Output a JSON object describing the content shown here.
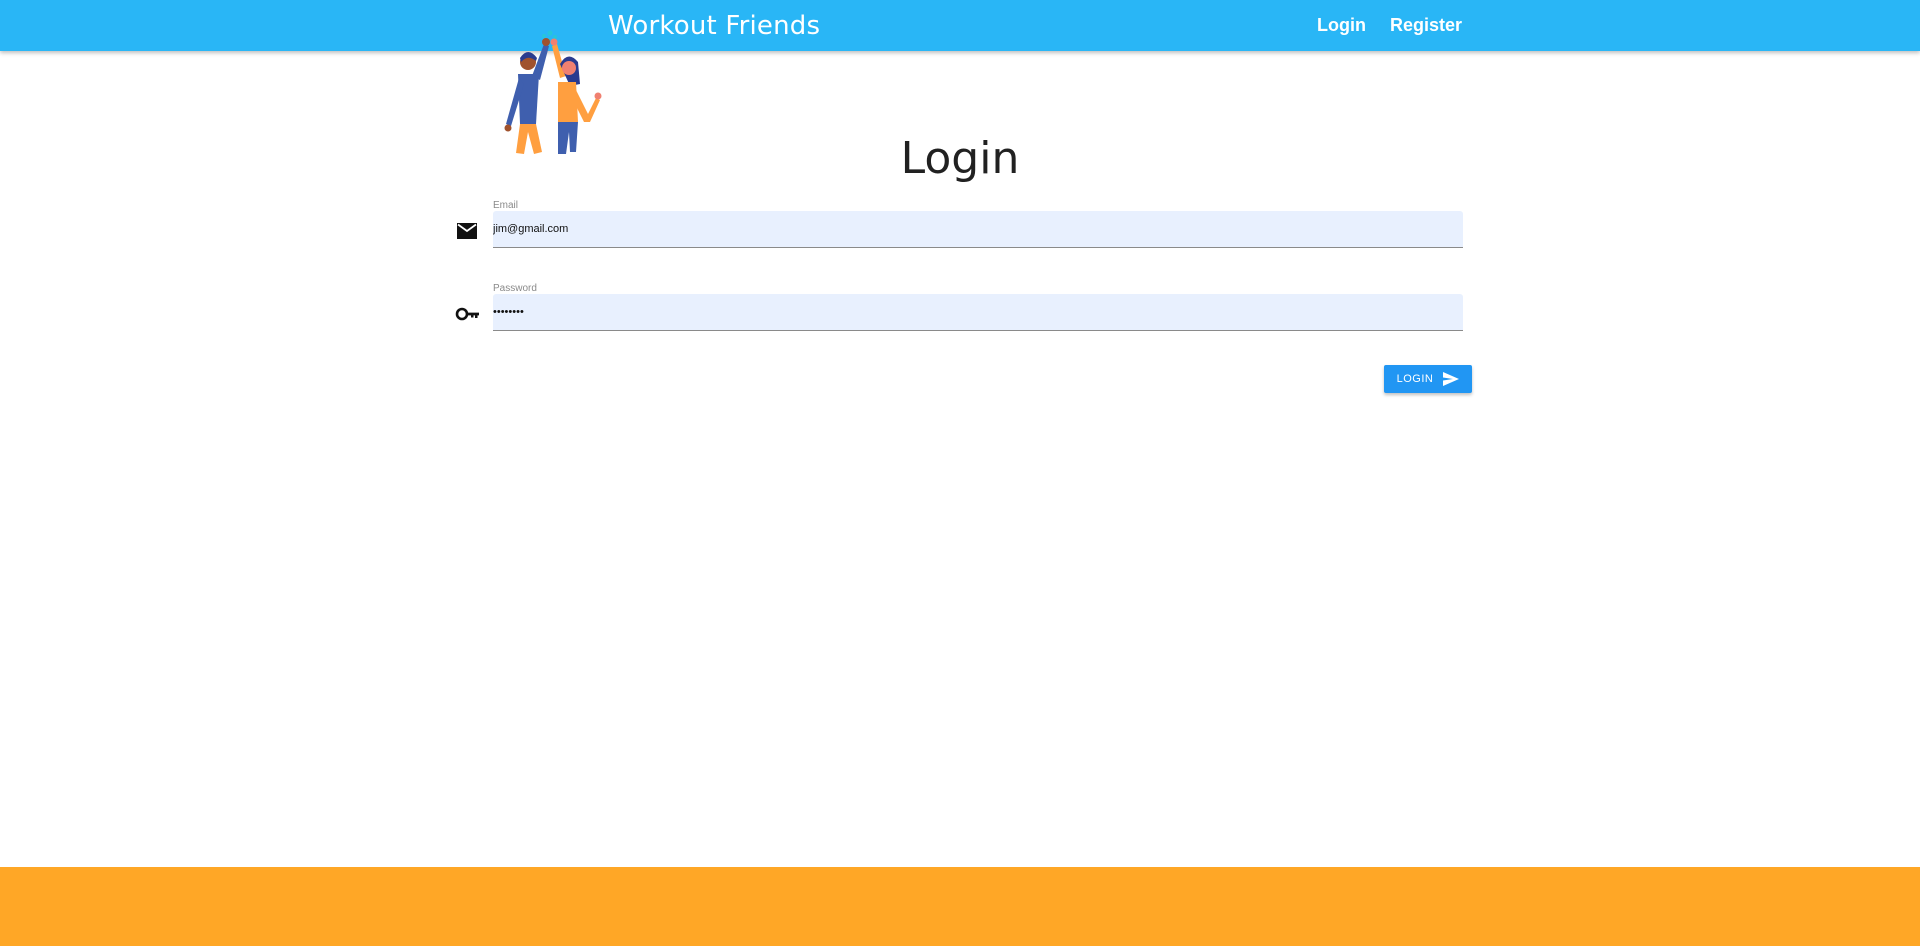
{
  "header": {
    "brand": "Workout Friends",
    "nav": {
      "login": "Login",
      "register": "Register"
    }
  },
  "page": {
    "title": "Login"
  },
  "form": {
    "email": {
      "label": "Email",
      "value": "jim@gmail.com",
      "icon": "mail-icon"
    },
    "password": {
      "label": "Password",
      "value": "••••••••",
      "icon": "key-icon"
    },
    "submit": {
      "label": "LOGIN",
      "icon": "send-icon"
    }
  },
  "colors": {
    "header": "#29b6f6",
    "button": "#2196f3",
    "footer": "#ffa726",
    "field_bg": "#e8f0fe"
  }
}
